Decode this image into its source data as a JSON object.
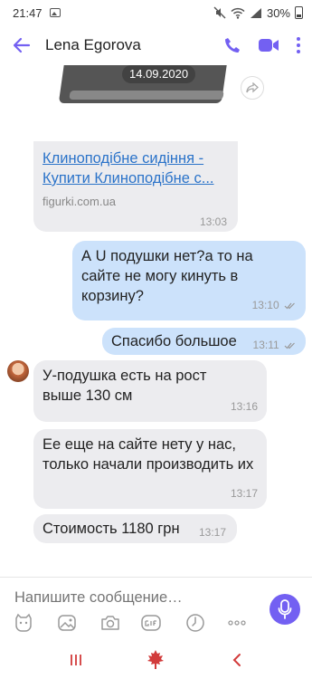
{
  "status": {
    "time": "21:47",
    "battery": "30%"
  },
  "header": {
    "contact_name": "Lena Egorova"
  },
  "colors": {
    "accent": "#7360f2",
    "outgoing_bubble": "#cce2fb",
    "incoming_bubble": "#ececef",
    "link": "#2b73c9",
    "nav_red": "#d23b3b"
  },
  "chat": {
    "date_pill": "14.09.2020",
    "link_message": {
      "title": "Клиноподібне сидіння - Купити Клиноподібне с...",
      "domain": "figurki.com.ua",
      "time": "13:03"
    },
    "messages": [
      {
        "direction": "out",
        "text": "А U подушки нет?а то на сайте не могу кинуть в корзину?",
        "time": "13:10"
      },
      {
        "direction": "out",
        "text": "Спасибо большое",
        "time": "13:11"
      },
      {
        "direction": "in",
        "text": "У-подушка есть на рост выше 130 см",
        "time": "13:16"
      },
      {
        "direction": "in",
        "text": "Ее еще на сайте нету у нас, только начали производить их",
        "time": "13:17"
      },
      {
        "direction": "in",
        "text": "Стоимость 1180 грн",
        "time": "13:17"
      }
    ]
  },
  "composer": {
    "placeholder": "Напишите сообщение…"
  },
  "icons": {
    "toolbar": [
      "sticker-icon",
      "gallery-icon",
      "camera-icon",
      "gif-icon",
      "clock-icon",
      "more-icon"
    ],
    "navbar": [
      "recent-apps-icon",
      "home-icon",
      "back-nav-icon"
    ]
  }
}
